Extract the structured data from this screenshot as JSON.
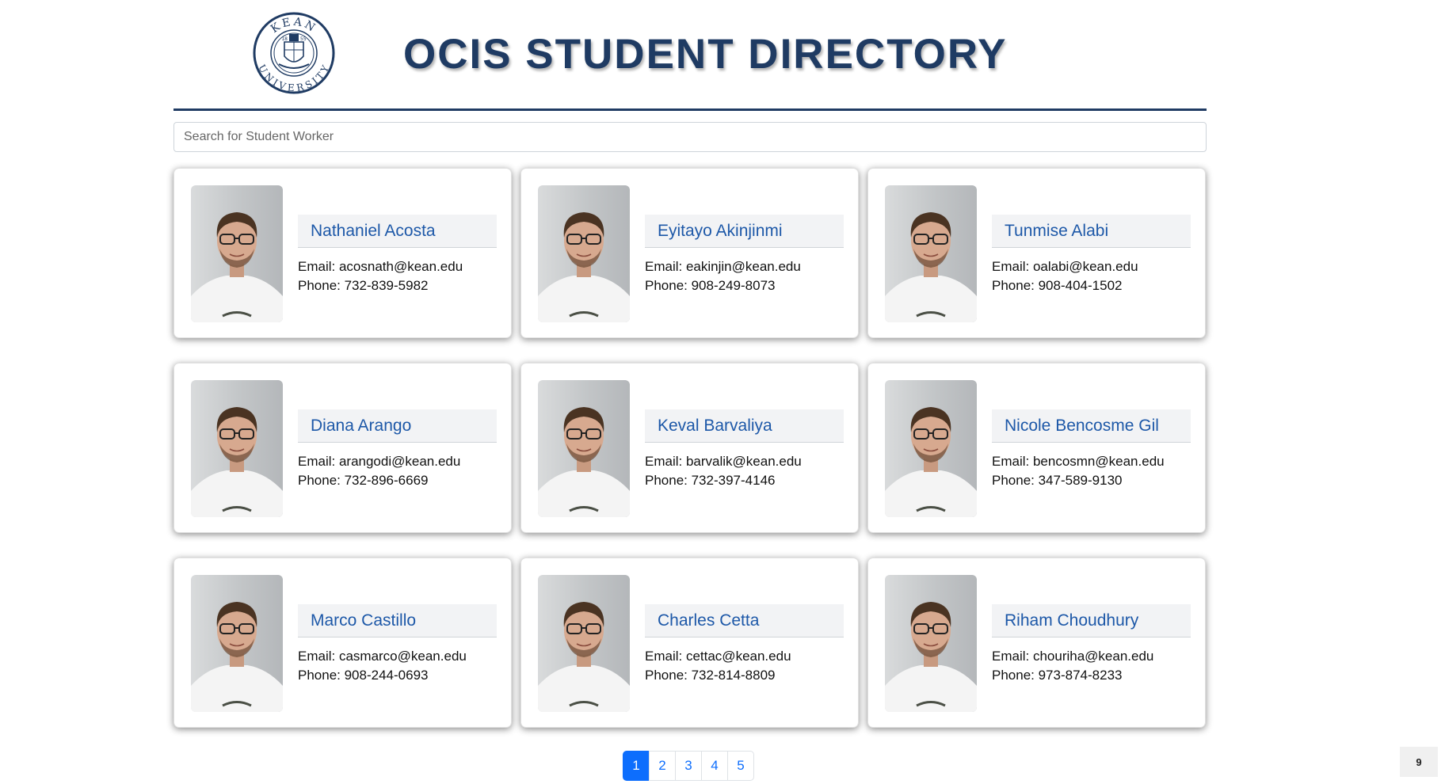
{
  "header": {
    "title": "OCIS STUDENT DIRECTORY",
    "logo": {
      "icon": "kean-university-seal-icon",
      "text_top": "KEAN",
      "text_bottom": "UNIVERSITY",
      "year_left": "18",
      "year_right": "55"
    }
  },
  "search": {
    "placeholder": "Search for Student Worker",
    "value": ""
  },
  "students": [
    {
      "name": "Nathaniel Acosta",
      "email": "Email: acosnath@kean.edu",
      "phone": "Phone: 732-839-5982"
    },
    {
      "name": "Eyitayo Akinjinmi",
      "email": "Email: eakinjin@kean.edu",
      "phone": "Phone: 908-249-8073"
    },
    {
      "name": "Tunmise Alabi",
      "email": "Email: oalabi@kean.edu",
      "phone": "Phone: 908-404-1502"
    },
    {
      "name": "Diana Arango",
      "email": "Email: arangodi@kean.edu",
      "phone": "Phone: 732-896-6669"
    },
    {
      "name": "Keval Barvaliya",
      "email": "Email: barvalik@kean.edu",
      "phone": "Phone: 732-397-4146"
    },
    {
      "name": "Nicole Bencosme Gil",
      "email": "Email: bencosmn@kean.edu",
      "phone": "Phone: 347-589-9130"
    },
    {
      "name": "Marco Castillo",
      "email": "Email: casmarco@kean.edu",
      "phone": "Phone: 908-244-0693"
    },
    {
      "name": "Charles Cetta",
      "email": "Email: cettac@kean.edu",
      "phone": "Phone: 732-814-8809"
    },
    {
      "name": "Riham Choudhury",
      "email": "Email: chouriha@kean.edu",
      "phone": "Phone: 973-874-8233"
    }
  ],
  "pagination": {
    "pages": [
      "1",
      "2",
      "3",
      "4",
      "5"
    ],
    "active": "1"
  },
  "count_badge": "9",
  "colors": {
    "brand_navy": "#1f3b63",
    "name_blue": "#1d58a8",
    "active_page": "#0d6efd"
  }
}
